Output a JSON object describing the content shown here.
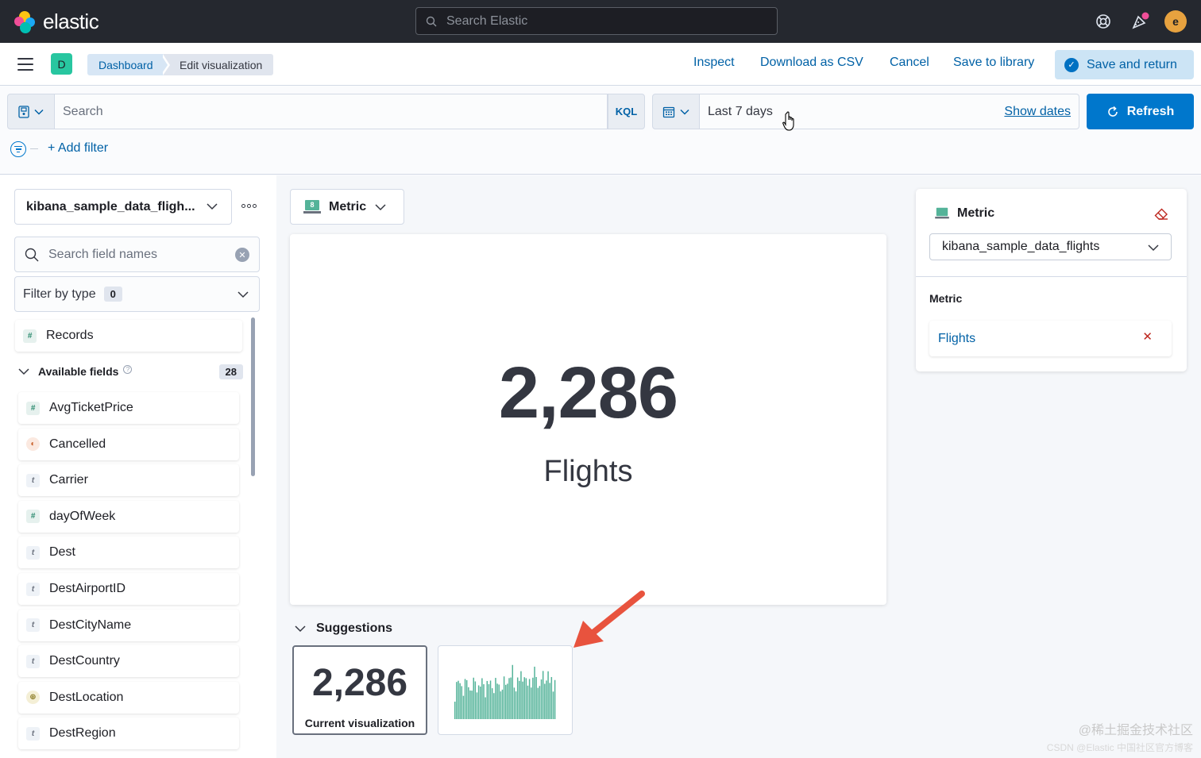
{
  "app": {
    "logo_text": "elastic",
    "global_search_placeholder": "Search Elastic",
    "avatar_initial": "e"
  },
  "nav": {
    "space_initial": "D",
    "breadcrumbs": [
      "Dashboard",
      "Edit visualization"
    ],
    "actions": {
      "inspect": "Inspect",
      "download_csv": "Download as CSV",
      "cancel": "Cancel",
      "save_to_library": "Save to library",
      "save_and_return": "Save and return"
    }
  },
  "query": {
    "search_placeholder": "Search",
    "language": "KQL",
    "time_range": "Last 7 days",
    "show_dates": "Show dates",
    "refresh": "Refresh",
    "add_filter": "+ Add filter"
  },
  "fields_panel": {
    "index_pattern": "kibana_sample_data_fligh...",
    "search_placeholder": "Search field names",
    "filter_by_type": "Filter by type",
    "filter_count": "0",
    "records_label": "Records",
    "available_fields_label": "Available fields",
    "available_fields_count": "28",
    "fields": [
      {
        "name": "AvgTicketPrice",
        "type": "number",
        "glyph": "#"
      },
      {
        "name": "Cancelled",
        "type": "boolean",
        "glyph": "◐"
      },
      {
        "name": "Carrier",
        "type": "string",
        "glyph": "t"
      },
      {
        "name": "dayOfWeek",
        "type": "number",
        "glyph": "#"
      },
      {
        "name": "Dest",
        "type": "string",
        "glyph": "t"
      },
      {
        "name": "DestAirportID",
        "type": "string",
        "glyph": "t"
      },
      {
        "name": "DestCityName",
        "type": "string",
        "glyph": "t"
      },
      {
        "name": "DestCountry",
        "type": "string",
        "glyph": "t"
      },
      {
        "name": "DestLocation",
        "type": "geo",
        "glyph": "⊕"
      },
      {
        "name": "DestRegion",
        "type": "string",
        "glyph": "t"
      }
    ]
  },
  "workspace": {
    "chart_type": "Metric",
    "metric_value": "2,286",
    "metric_label": "Flights",
    "suggestions_label": "Suggestions",
    "suggestion_current_value": "2,286",
    "suggestion_current_label": "Current visualization"
  },
  "config_panel": {
    "title": "Metric",
    "index_pattern": "kibana_sample_data_flights",
    "group_label": "Metric",
    "dimension": "Flights"
  },
  "watermark": {
    "line1": "@稀土掘金技术社区",
    "line2": "CSDN @Elastic 中国社区官方博客"
  },
  "colors": {
    "accent": "#0077cc",
    "header_bg": "#25282f",
    "bar_green": "#54b399",
    "danger": "#bd271e",
    "arrow": "#e8533e"
  }
}
